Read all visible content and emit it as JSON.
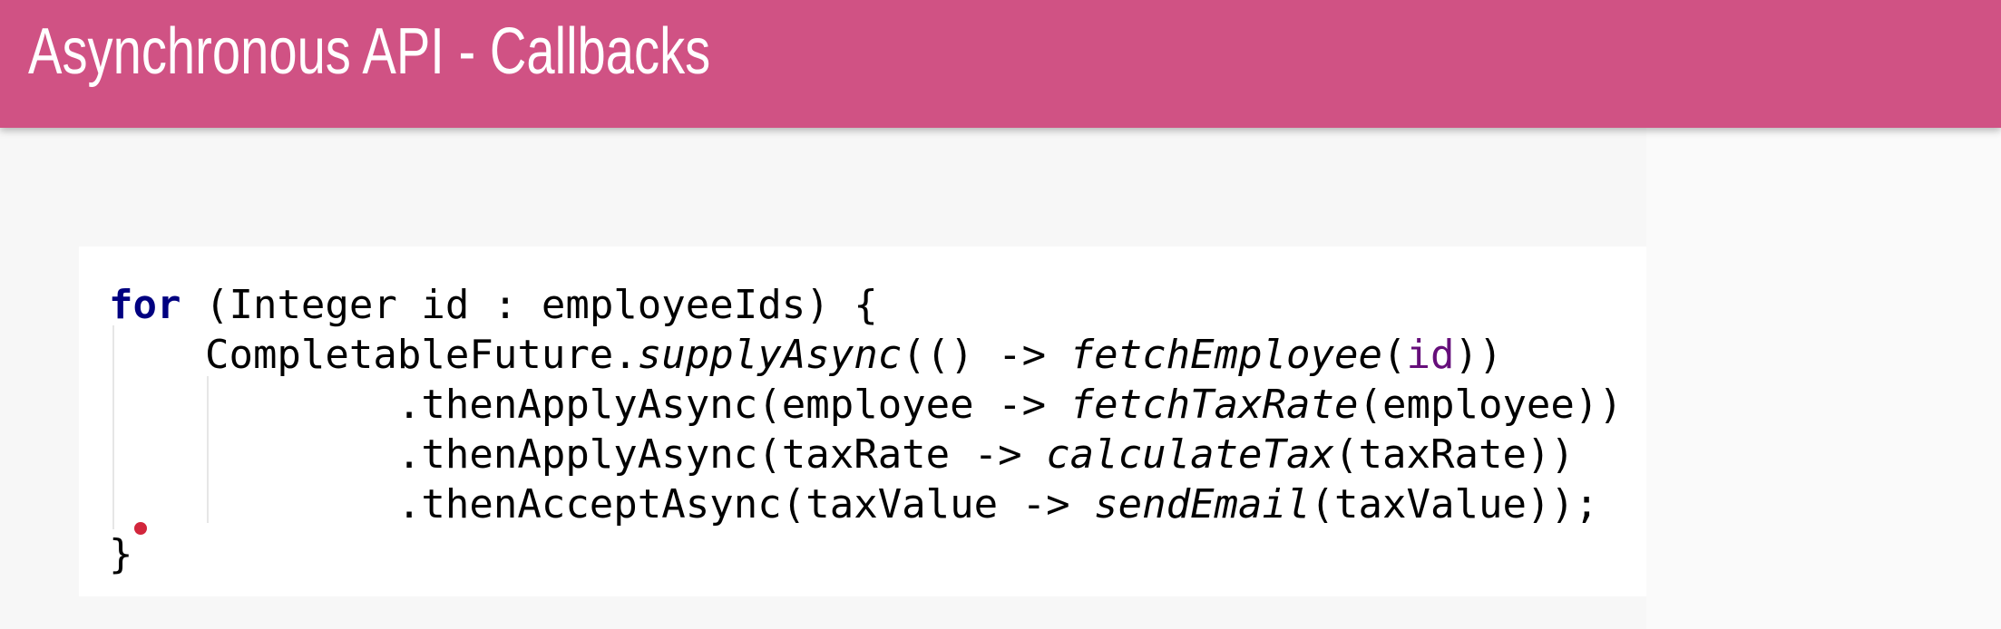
{
  "header": {
    "title": "Asynchronous API - Callbacks"
  },
  "colors": {
    "header_bg": "#d05284",
    "keyword": "#000080",
    "variable": "#660e7a",
    "breakpoint_dot": "#d2263c"
  },
  "code": {
    "lines": [
      [
        {
          "t": "for",
          "s": "kw"
        },
        {
          "t": " (Integer id : employeeIds) {",
          "s": ""
        }
      ],
      [
        {
          "t": "    CompletableFuture.",
          "s": ""
        },
        {
          "t": "supplyAsync",
          "s": "it"
        },
        {
          "t": "(() -> ",
          "s": ""
        },
        {
          "t": "fetchEmployee",
          "s": "it"
        },
        {
          "t": "(",
          "s": ""
        },
        {
          "t": "id",
          "s": "var"
        },
        {
          "t": "))",
          "s": ""
        }
      ],
      [
        {
          "t": "            .thenApplyAsync(employee -> ",
          "s": ""
        },
        {
          "t": "fetchTaxRate",
          "s": "it"
        },
        {
          "t": "(employee))",
          "s": ""
        }
      ],
      [
        {
          "t": "            .thenApplyAsync(taxRate -> ",
          "s": ""
        },
        {
          "t": "calculateTax",
          "s": "it"
        },
        {
          "t": "(taxRate))",
          "s": ""
        }
      ],
      [
        {
          "t": "            .thenAcceptAsync(taxValue -> ",
          "s": ""
        },
        {
          "t": "sendEmail",
          "s": "it"
        },
        {
          "t": "(taxValue));",
          "s": ""
        }
      ],
      [
        {
          "t": "}",
          "s": ""
        }
      ]
    ]
  }
}
